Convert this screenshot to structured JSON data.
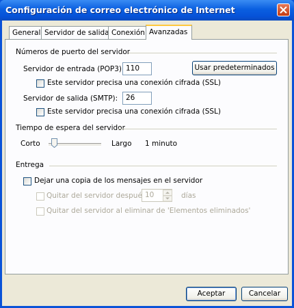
{
  "window": {
    "title": "Configuración de correo electrónico de Internet"
  },
  "tabs": [
    "General",
    "Servidor de salida",
    "Conexión",
    "Avanzadas"
  ],
  "ports_group": {
    "title": "Números de puerto del servidor",
    "incoming_label": "Servidor de entrada (POP3):",
    "incoming_value": "110",
    "defaults_button": "Usar predeterminados",
    "incoming_ssl": "Este servidor precisa una conexión cifrada (SSL)",
    "outgoing_label": "Servidor de salida (SMTP):",
    "outgoing_value": "26",
    "outgoing_ssl": "Este servidor precisa una conexión cifrada (SSL)"
  },
  "timeout_group": {
    "title": "Tiempo de espera del servidor",
    "short_label": "Corto",
    "long_label": "Largo",
    "value_text": "1 minuto",
    "level": 0.1
  },
  "delivery_group": {
    "title": "Entrega",
    "leave_copy": "Dejar una copia de los mensajes en el servidor",
    "remove_after": "Quitar del servidor después",
    "days_value": "10",
    "days_unit": "días",
    "remove_on_delete": "Quitar del servidor al eliminar de 'Elementos eliminados'"
  },
  "footer": {
    "accept": "Aceptar",
    "cancel": "Cancelar"
  },
  "colors": {
    "titlebar": "#0a5fe0",
    "client": "#ece9d8",
    "active_tab_accent": "#ffc83c"
  }
}
